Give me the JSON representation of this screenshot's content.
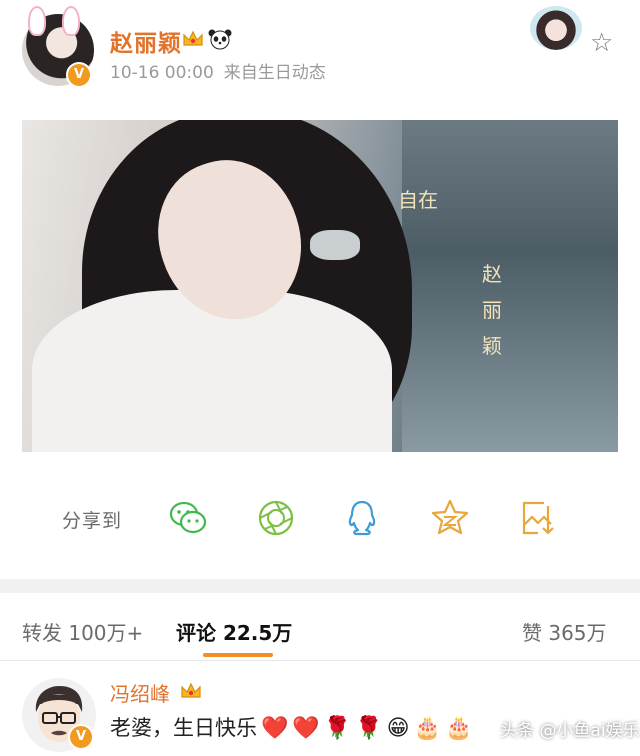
{
  "post": {
    "author": "赵丽颖",
    "time": "10-16 00:00",
    "source": "来自生日动态",
    "icons": {
      "crown": "crown-icon",
      "panda": "panda-icon",
      "verified": "verified-v-icon"
    }
  },
  "photo": {
    "calligraphy_line1": "自在",
    "calligraphy_line2": "赵丽颖"
  },
  "share": {
    "label": "分享到",
    "targets": [
      "wechat",
      "moments",
      "qq",
      "qzone",
      "save-image"
    ]
  },
  "tabs": {
    "repost": "转发 100万+",
    "comment": "评论 22.5万",
    "like": "赞 365万"
  },
  "comment": {
    "author": "冯绍峰",
    "text": "老婆，生日快乐",
    "emojis": [
      "❤️",
      "❤️",
      "🌹",
      "🌹",
      "😁",
      "🎂",
      "🎂"
    ]
  },
  "watermark": "头条 @小鱼ai娱乐",
  "colors": {
    "accent": "#e1732b",
    "underline": "#f58c2b",
    "share_green": "#3fb950",
    "share_blue": "#3d9bd8",
    "share_gold": "#e9a63a"
  }
}
